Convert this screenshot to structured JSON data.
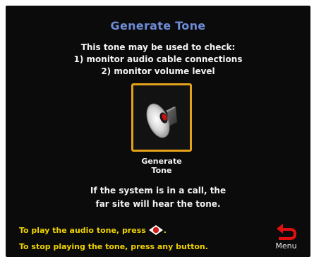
{
  "screen": {
    "title": "Generate Tone",
    "intro_lines": [
      "This tone may be used to check:",
      "1) monitor audio cable connections",
      "2) monitor volume level"
    ],
    "tile": {
      "icon": "speaker-icon",
      "label_lines": [
        "Generate",
        "Tone"
      ]
    },
    "note_lines": [
      "If the system is in a call, the",
      "far site will hear the tone."
    ],
    "hint_lines": [
      "To play the audio tone, press",
      ".",
      "To stop playing the tone, press any button."
    ],
    "menu": {
      "icon": "back-arrow-icon",
      "label": "Menu"
    }
  },
  "colors": {
    "background": "#0b0b0b",
    "title": "#6d8bd6",
    "tile_border": "#e4a21b",
    "hint": "#f0d200",
    "back_arrow": "#e01010"
  }
}
